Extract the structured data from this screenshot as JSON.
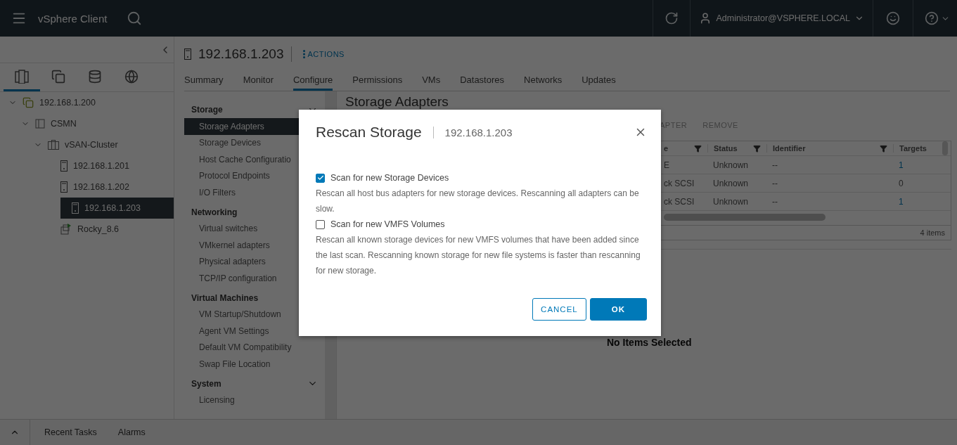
{
  "header": {
    "app_title": "vSphere Client",
    "user": "Administrator@VSPHERE.LOCAL"
  },
  "navigator": {
    "view_tabs": [
      {
        "kind": "hosts",
        "selected": true
      },
      {
        "kind": "vms",
        "selected": false
      },
      {
        "kind": "storage",
        "selected": false
      },
      {
        "kind": "network",
        "selected": false
      }
    ],
    "tree": [
      {
        "label": "192.168.1.200",
        "kind": "vcenter",
        "expanded": true,
        "selected": false,
        "children": [
          {
            "label": "CSMN",
            "kind": "datacenter",
            "expanded": true,
            "selected": false,
            "children": [
              {
                "label": "vSAN-Cluster",
                "kind": "cluster",
                "expanded": true,
                "selected": false,
                "children": [
                  {
                    "label": "192.168.1.201",
                    "kind": "host",
                    "selected": false
                  },
                  {
                    "label": "192.168.1.202",
                    "kind": "host",
                    "selected": false
                  },
                  {
                    "label": "192.168.1.203",
                    "kind": "host",
                    "selected": true
                  },
                  {
                    "label": "Rocky_8.6",
                    "kind": "vm",
                    "selected": false
                  }
                ]
              }
            ]
          }
        ]
      }
    ]
  },
  "object": {
    "title": "192.168.1.203",
    "actions": "ACTIONS",
    "tabs": [
      {
        "label": "Summary",
        "selected": false
      },
      {
        "label": "Monitor",
        "selected": false
      },
      {
        "label": "Configure",
        "selected": true
      },
      {
        "label": "Permissions",
        "selected": false
      },
      {
        "label": "VMs",
        "selected": false
      },
      {
        "label": "Datastores",
        "selected": false
      },
      {
        "label": "Networks",
        "selected": false
      },
      {
        "label": "Updates",
        "selected": false
      }
    ]
  },
  "config_nav": [
    {
      "title": "Storage",
      "expanded": true,
      "items": [
        {
          "label": "Storage Adapters",
          "selected": true
        },
        {
          "label": "Storage Devices",
          "selected": false
        },
        {
          "label": "Host Cache Configuratio",
          "selected": false
        },
        {
          "label": "Protocol Endpoints",
          "selected": false
        },
        {
          "label": "I/O Filters",
          "selected": false
        }
      ]
    },
    {
      "title": "Networking",
      "items": [
        {
          "label": "Virtual switches",
          "selected": false
        },
        {
          "label": "VMkernel adapters",
          "selected": false
        },
        {
          "label": "Physical adapters",
          "selected": false
        },
        {
          "label": "TCP/IP configuration",
          "selected": false
        }
      ]
    },
    {
      "title": "Virtual Machines",
      "items": [
        {
          "label": "VM Startup/Shutdown",
          "selected": false
        },
        {
          "label": "Agent VM Settings",
          "selected": false
        },
        {
          "label": "Default VM Compatibility",
          "selected": false
        },
        {
          "label": "Swap File Location",
          "selected": false
        }
      ]
    },
    {
      "title": "System",
      "expanded": true,
      "items": [
        {
          "label": "Licensing",
          "selected": false
        }
      ]
    }
  ],
  "content": {
    "title": "Storage Adapters",
    "toolbar": [
      "APTER",
      "REMOVE"
    ],
    "table": {
      "columns": [
        "e",
        "Status",
        "Identifier",
        "Targets"
      ],
      "rows": [
        [
          "E",
          "Unknown",
          "--",
          "1"
        ],
        [
          "ck SCSI",
          "Unknown",
          "--",
          "0"
        ],
        [
          "ck SCSI",
          "Unknown",
          "--",
          "1"
        ]
      ],
      "footer": "4 items"
    },
    "detail": "No Items Selected"
  },
  "dialog": {
    "title": "Rescan Storage",
    "subtitle": "192.168.1.203",
    "options": [
      {
        "label": "Scan for new Storage Devices",
        "checked": true,
        "description": "Rescan all host bus adapters for new storage devices. Rescanning all adapters can be slow."
      },
      {
        "label": "Scan for new VMFS Volumes",
        "checked": false,
        "description": "Rescan all known storage devices for new VMFS volumes that have been added since the last scan. Rescanning known storage for new file systems is faster than rescanning for new storage."
      }
    ],
    "buttons": [
      {
        "label": "CANCEL",
        "kind": "secondary"
      },
      {
        "label": "OK",
        "kind": "primary"
      }
    ]
  },
  "bottom_bar": {
    "expanded": false,
    "tabs": [
      "Recent Tasks",
      "Alarms"
    ]
  }
}
